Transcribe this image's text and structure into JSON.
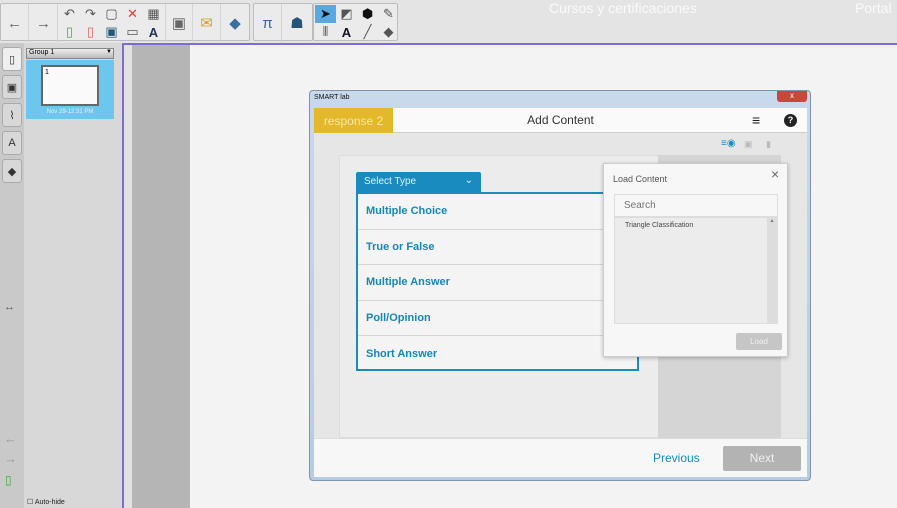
{
  "top_overlay": {
    "left": "Cursos y certificaciones",
    "right": "Portal"
  },
  "toolbar": {
    "icons": [
      "back-arrow",
      "forward-arrow",
      "undo",
      "redo",
      "paste",
      "delete",
      "table",
      "add-page",
      "delete-page",
      "save",
      "screen-shade",
      "handwriting",
      "display",
      "activities",
      "lab-addin",
      "math",
      "maps",
      "select",
      "shapes",
      "fill",
      "pen",
      "measure",
      "text",
      "line",
      "eraser"
    ]
  },
  "sorter": {
    "group": "Group 1",
    "page_number": "1",
    "page_date": "Nov 29-12:31 PM",
    "autohide": "Auto-hide"
  },
  "dialog": {
    "title": "SMART lab",
    "close": "x",
    "tab": "response 2",
    "header": "Add Content",
    "select_type": "Select Type",
    "types": [
      "Multiple Choice",
      "True or False",
      "Multiple Answer",
      "Poll/Opinion",
      "Short Answer"
    ],
    "load": {
      "title": "Load Content",
      "close": "×",
      "search_placeholder": "Search",
      "items": [
        "Triangle Classification"
      ],
      "button": "Load"
    },
    "previous": "Previous",
    "next": "Next"
  },
  "colors": {
    "accent": "#1a8bbf",
    "tab": "#e3b82a"
  }
}
